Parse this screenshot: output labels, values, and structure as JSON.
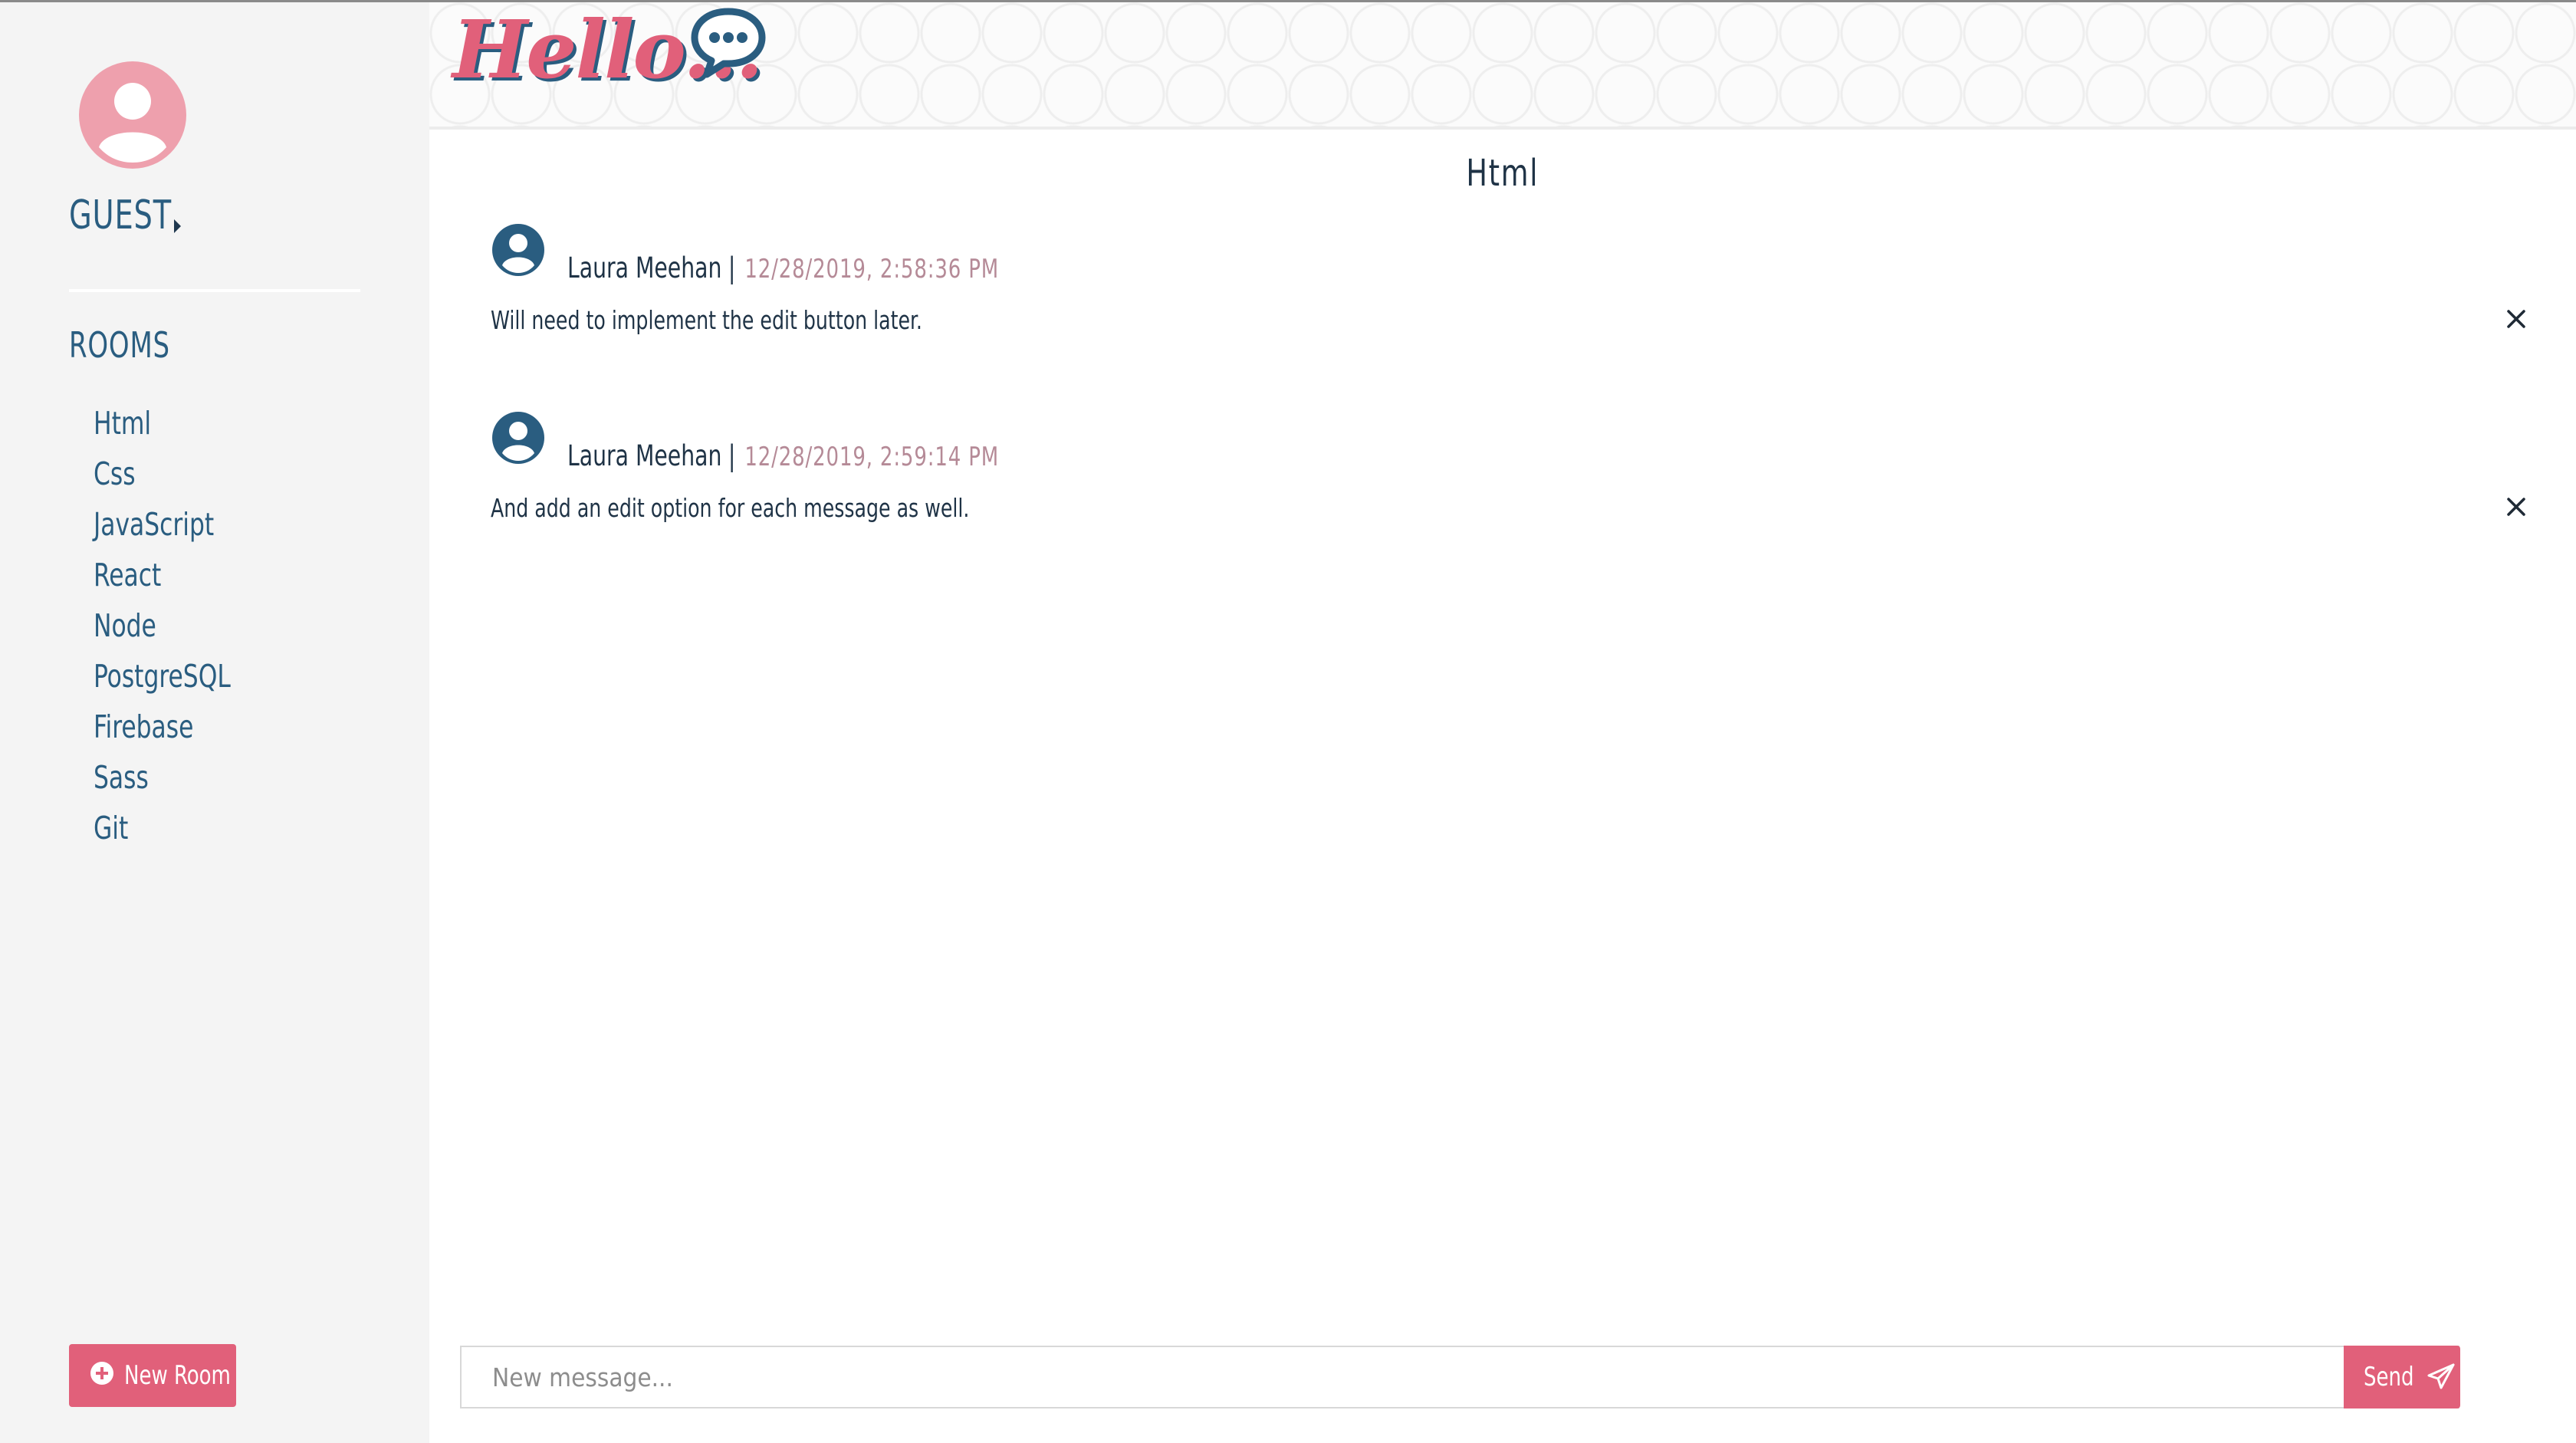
{
  "colors": {
    "accent_pink": "#e1607a",
    "brand_blue": "#2a5d80",
    "text_dark": "#1f3346",
    "timestamp": "#b58a97",
    "sidebar_bg": "#f4f4f4"
  },
  "header": {
    "logo_text": "Hello...",
    "logo_icon": "chat-bubble-dots-icon"
  },
  "sidebar": {
    "user_label": "GUEST",
    "user_icon": "user-avatar-icon",
    "rooms_title": "ROOMS",
    "rooms": [
      {
        "label": "Html"
      },
      {
        "label": "Css"
      },
      {
        "label": "JavaScript"
      },
      {
        "label": "React"
      },
      {
        "label": "Node"
      },
      {
        "label": "PostgreSQL"
      },
      {
        "label": "Firebase"
      },
      {
        "label": "Sass"
      },
      {
        "label": "Git"
      }
    ],
    "new_room_label": "New Room",
    "new_room_icon": "plus-circle-icon"
  },
  "chat": {
    "room_title": "Html",
    "messages": [
      {
        "author": "Laura Meehan",
        "separator": "|",
        "time": "12/28/2019, 2:58:36 PM",
        "text": "Will need to implement the edit button later."
      },
      {
        "author": "Laura Meehan",
        "separator": "|",
        "time": "12/28/2019, 2:59:14 PM",
        "text": "And add an edit option for each message as well."
      }
    ]
  },
  "composer": {
    "placeholder": "New message...",
    "value": "",
    "send_label": "Send",
    "send_icon": "paper-plane-icon"
  }
}
